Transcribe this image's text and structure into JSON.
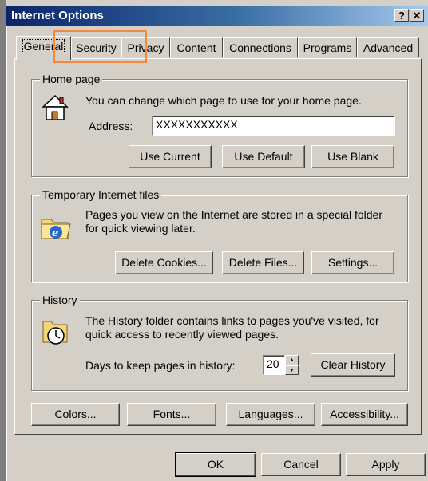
{
  "window": {
    "title": "Internet Options",
    "help_label": "?",
    "close_label": "✕"
  },
  "tabs": [
    "General",
    "Security",
    "Privacy",
    "Content",
    "Connections",
    "Programs",
    "Advanced"
  ],
  "home_page": {
    "legend": "Home page",
    "description": "You can change which page to use for your home page.",
    "address_label": "Address:",
    "address_value": "XXXXXXXXXXX",
    "use_current": "Use Current",
    "use_default": "Use Default",
    "use_blank": "Use Blank"
  },
  "temp_files": {
    "legend": "Temporary Internet files",
    "description_line1": "Pages you view on the Internet are stored in a special folder",
    "description_line2": "for quick viewing later.",
    "delete_cookies": "Delete Cookies...",
    "delete_files": "Delete Files...",
    "settings": "Settings..."
  },
  "history": {
    "legend": "History",
    "description_line1": "The History folder contains links to pages you've visited, for",
    "description_line2": "quick access to recently viewed pages.",
    "days_label": "Days to keep pages in history:",
    "days_value": "20",
    "clear_history": "Clear History"
  },
  "bottom_buttons": {
    "colors": "Colors...",
    "fonts": "Fonts...",
    "languages": "Languages...",
    "accessibility": "Accessibility..."
  },
  "dialog_buttons": {
    "ok": "OK",
    "cancel": "Cancel",
    "apply": "Apply"
  },
  "colors": {
    "titlebar_start": "#0a246a",
    "titlebar_end": "#a6caf0",
    "face": "#d4d0c8",
    "highlight": "#f58a3c"
  }
}
